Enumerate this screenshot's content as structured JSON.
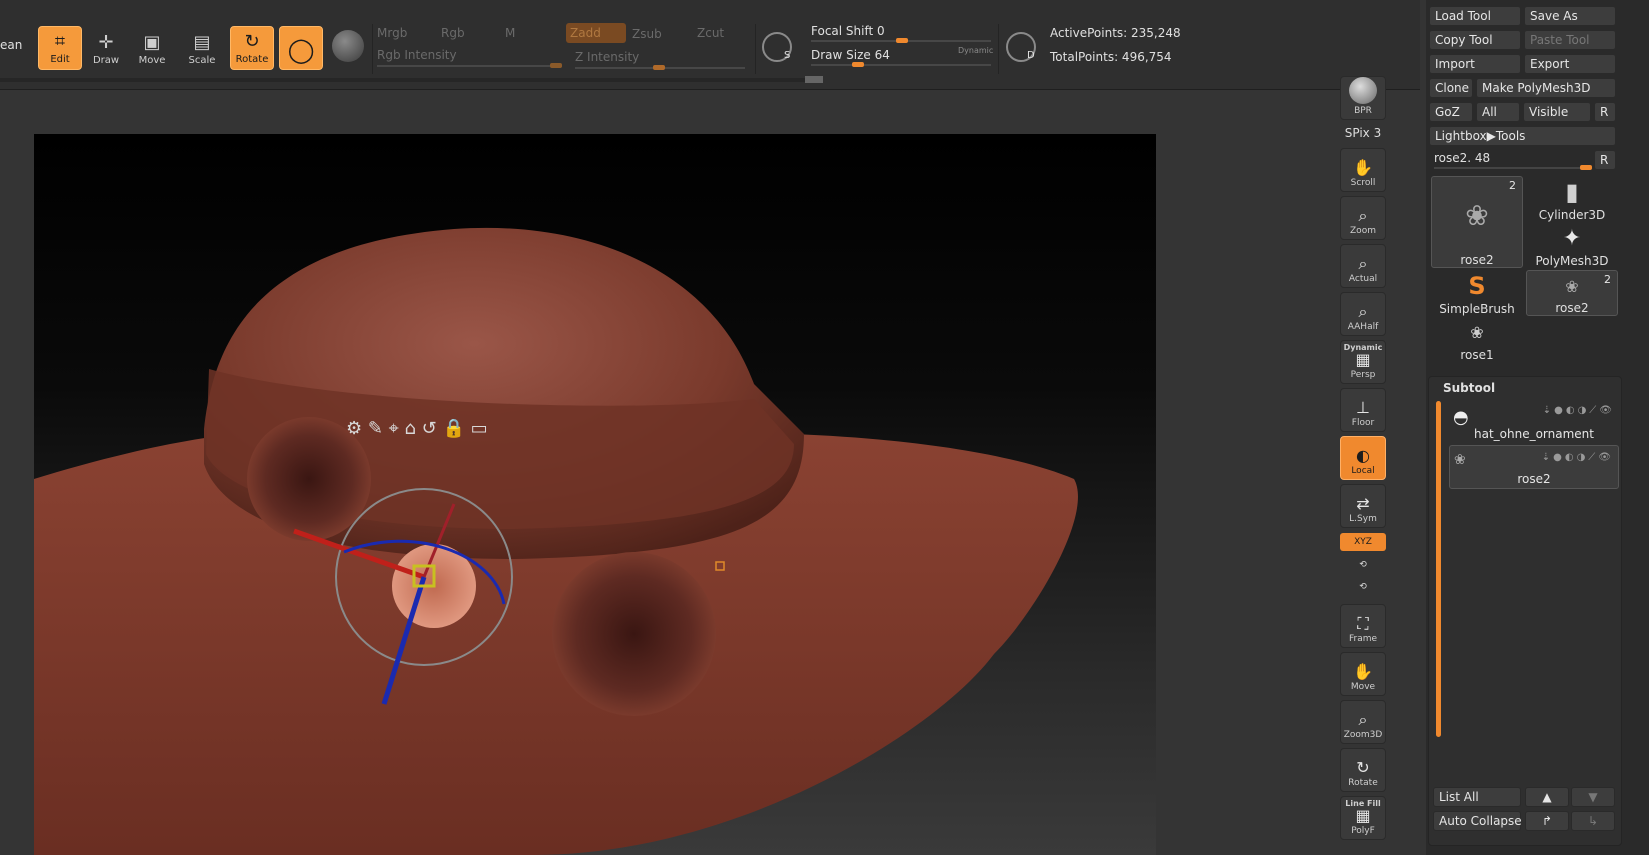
{
  "toolbar": {
    "clean_partial": "ean",
    "edit": "Edit",
    "draw": "Draw",
    "move": "Move",
    "scale": "Scale",
    "rotate": "Rotate",
    "mrgb": "Mrgb",
    "rgb": "Rgb",
    "m": "M",
    "zadd": "Zadd",
    "zsub": "Zsub",
    "zcut": "Zcut",
    "rgb_intensity": "Rgb Intensity",
    "z_intensity": "Z Intensity",
    "focal_shift_label": "Focal Shift",
    "focal_shift_value": "0",
    "draw_size_label": "Draw Size",
    "draw_size_value": "64",
    "dynamic": "Dynamic",
    "s_badge": "S",
    "d_badge": "D",
    "active_points": "ActivePoints: 235,248",
    "total_points": "TotalPoints: 496,754"
  },
  "shelf": {
    "bpr": "BPR",
    "spix": "SPix 3",
    "scroll": "Scroll",
    "zoom": "Zoom",
    "actual": "Actual",
    "aahalf": "AAHalf",
    "dynamic": "Dynamic",
    "persp": "Persp",
    "floor": "Floor",
    "local": "Local",
    "lsym": "L.Sym",
    "xyz": "XYZ",
    "frame": "Frame",
    "move": "Move",
    "zoom3d": "Zoom3D",
    "rotate": "Rotate",
    "line_fill": "Line Fill",
    "polyf": "PolyF"
  },
  "tool_panel": {
    "load_tool": "Load Tool",
    "save_as": "Save As",
    "copy_tool": "Copy Tool",
    "paste_tool": "Paste Tool",
    "import": "Import",
    "export": "Export",
    "clone": "Clone",
    "make_polymesh": "Make PolyMesh3D",
    "goz": "GoZ",
    "all": "All",
    "visible": "Visible",
    "r": "R",
    "lightbox_tools": "Lightbox▶Tools",
    "current_tool": "rose2. 48",
    "r2": "R",
    "thumbs": [
      {
        "name": "rose2",
        "badge": "2"
      },
      {
        "name": "Cylinder3D",
        "badge": ""
      },
      {
        "name": "PolyMesh3D",
        "badge": ""
      },
      {
        "name": "SimpleBrush",
        "badge": ""
      },
      {
        "name": "rose2",
        "badge": "2"
      },
      {
        "name": "rose1",
        "badge": ""
      }
    ]
  },
  "subtool": {
    "title": "Subtool",
    "items": [
      {
        "name": "hat_ohne_ornament"
      },
      {
        "name": "rose2"
      }
    ],
    "list_all": "List All",
    "auto_collapse": "Auto Collapse"
  },
  "colors": {
    "accent": "#f0892e",
    "hat": "#7a3a2c",
    "rose": "#5a2a22"
  }
}
